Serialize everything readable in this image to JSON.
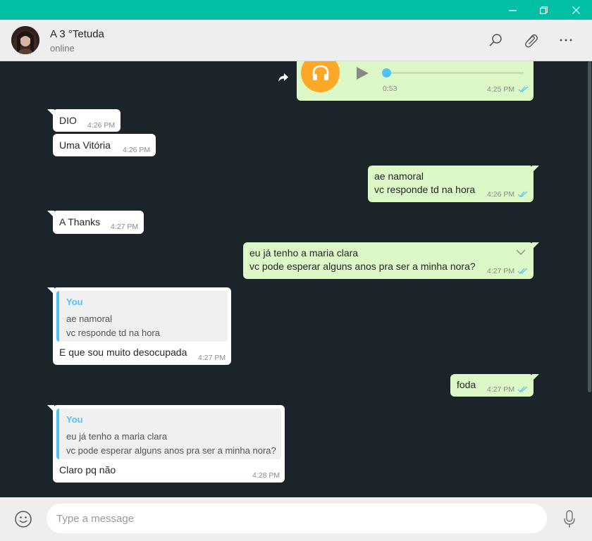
{
  "window": {
    "controls": [
      "minimize-icon",
      "restore-icon",
      "close-icon"
    ]
  },
  "header": {
    "contact_name": "A 3 °Tetuda",
    "status": "online",
    "icons": [
      "search-icon",
      "paperclip-icon",
      "more-icon"
    ]
  },
  "messages": {
    "voice": {
      "duration": "0:53",
      "time": "4:25 PM",
      "progress": 0
    },
    "m1": {
      "text": "DIO",
      "time": "4:26 PM"
    },
    "m2": {
      "text": "Uma Vitória",
      "time": "4:26 PM"
    },
    "m3": {
      "line1": "ae namoral",
      "line2": "vc responde td na hora",
      "time": "4:26 PM"
    },
    "m4": {
      "text": "A Thanks",
      "time": "4:27 PM"
    },
    "m5": {
      "line1": "eu já tenho a maria clara",
      "line2": "vc pode esperar alguns anos pra ser  a minha nora?",
      "time": "4:27 PM"
    },
    "m6": {
      "quote_author": "You",
      "quote_line1": "ae namoral",
      "quote_line2": "vc responde td na hora",
      "text": "E que sou muito desocupada",
      "time": "4:27 PM"
    },
    "m7": {
      "text": "foda",
      "time": "4:27 PM"
    },
    "m8": {
      "quote_author": "You",
      "quote_line1": "eu já tenho a maria clara",
      "quote_line2": "vc pode esperar alguns anos pra ser  a minha nora?",
      "text": "Claro pq não",
      "time": "4:28 PM"
    }
  },
  "composer": {
    "placeholder": "Type a message",
    "value": ""
  },
  "colors": {
    "accent": "#00bfa5",
    "outgoing_bubble": "#dcf8c6",
    "incoming_bubble": "#ffffff",
    "chat_background": "#1a2429",
    "read_ticks": "#4fc3f7",
    "audio_icon": "#ffa726"
  }
}
